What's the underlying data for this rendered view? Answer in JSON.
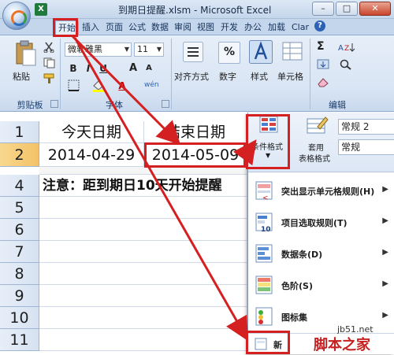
{
  "window": {
    "title": "到期日提醒.xlsm - Microsoft Excel",
    "min": "–",
    "max": "□",
    "close": "✕"
  },
  "qat": {
    "excel_icon": "X"
  },
  "tabs": [
    "开始",
    "插入",
    "页面",
    "公式",
    "数据",
    "审阅",
    "视图",
    "开发",
    "办公",
    "加载",
    "Clar"
  ],
  "help_icon": "?",
  "ribbon": {
    "clipboard": {
      "paste": "粘贴",
      "group": "剪贴板"
    },
    "font": {
      "font_name": "微软雅黑",
      "font_size": "11",
      "bold": "B",
      "italic": "I",
      "underline": "U",
      "grow": "A",
      "shrink": "A",
      "phonetic": "wén",
      "group": "字体"
    },
    "alignment": {
      "label": "对齐方式"
    },
    "number": {
      "label": "数字",
      "icon": "%"
    },
    "styles": {
      "label": "样式"
    },
    "cells": {
      "label": "单元格"
    },
    "editing": {
      "sigma": "Σ",
      "group": "编辑"
    }
  },
  "sheet": {
    "rows": [
      "1",
      "2",
      "4",
      "5",
      "6",
      "7",
      "8",
      "9",
      "10",
      "11"
    ],
    "header_a": "今天日期",
    "header_b": "结束日期",
    "today": "2014-04-29",
    "end": "2014-05-09",
    "note": "注意：距到期日10天开始提醒"
  },
  "cf_menu": {
    "conditional_format": "条件格式",
    "table_format_1": "套用",
    "table_format_2": "表格格式",
    "style_1": "常规 2",
    "style_2": "常规",
    "items": [
      {
        "label": "突出显示单元格规则(H)"
      },
      {
        "label": "项目选取规则(T)"
      },
      {
        "label": "数据条(D)"
      },
      {
        "label": "色阶(S)"
      },
      {
        "label": "图标集"
      },
      {
        "label": "新"
      }
    ],
    "icon_ten": "10"
  },
  "watermark": {
    "line1": "jb51.net",
    "line2": "脚本之家"
  },
  "colors": {
    "highlight": "#d42020",
    "accent": "#2b62b5"
  }
}
